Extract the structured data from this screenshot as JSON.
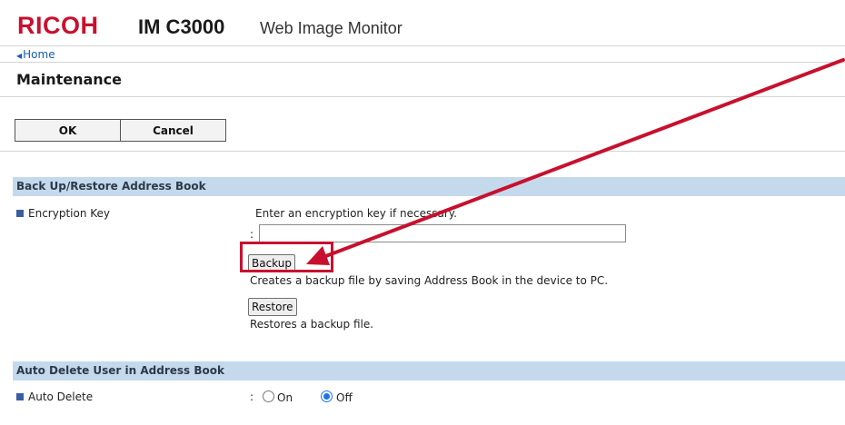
{
  "header": {
    "brand": "RICOH",
    "model": "IM C3000",
    "product": "Web Image Monitor"
  },
  "nav": {
    "home_link": "Home"
  },
  "page": {
    "title": "Maintenance"
  },
  "actions": {
    "ok_label": "OK",
    "cancel_label": "Cancel"
  },
  "backup_section": {
    "title": "Back Up/Restore Address Book",
    "encryption_label": "Encryption Key",
    "encryption_hint": "Enter an encryption key if necessary.",
    "colon": ":",
    "key_value": "",
    "backup_button": "Backup",
    "backup_desc": "Creates a backup file by saving Address Book in the device to PC.",
    "restore_button": "Restore",
    "restore_desc": "Restores a backup file."
  },
  "auto_delete_section": {
    "title": "Auto Delete User in Address Book",
    "label": "Auto Delete",
    "colon": ":",
    "options": [
      {
        "label": "On",
        "selected": false
      },
      {
        "label": "Off",
        "selected": true
      }
    ]
  },
  "annotation": {
    "highlight_color": "#c8102e",
    "arrow_color": "#c8102e"
  }
}
